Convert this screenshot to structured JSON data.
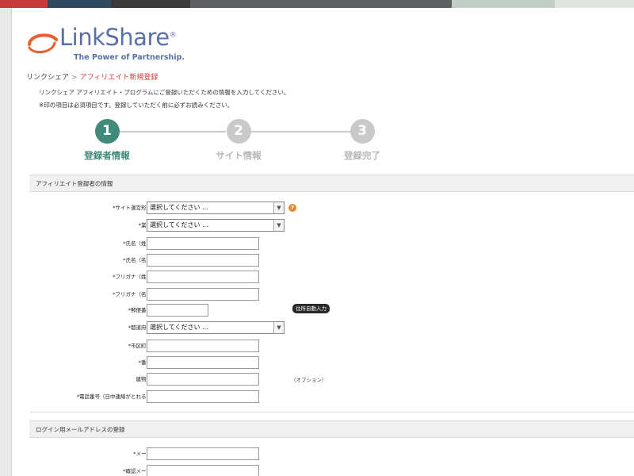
{
  "colors": {
    "topbar": [
      "#c53a3a",
      "#2f4a5e",
      "#3a3a3a",
      "#5f6061",
      "#6f7071",
      "#c3cfc6",
      "#e2e6e3"
    ],
    "logo_blue": "#5a6fa8",
    "logo_orange": "#e8602c",
    "step_active": "#3f8a7a",
    "step_inactive": "#c9c9c9",
    "breadcrumb_current": "#d13c3c"
  },
  "logo": {
    "name": "LinkShare",
    "registered": "®",
    "tagline": "The Power of Partnership."
  },
  "breadcrumb": {
    "home": "リンクシェア",
    "separator": ">",
    "current": "アフィリエイト新規登録"
  },
  "intro": {
    "line1": "リンクシェア アフィリエイト・プログラムにご登録いただくための情報を入力してください。",
    "line2": "※印の項目は必須項目です。登録していただく前に必ずお読みください。"
  },
  "steps": [
    {
      "number": "1",
      "label": "登録者情報",
      "active": true
    },
    {
      "number": "2",
      "label": "サイト情報",
      "active": false
    },
    {
      "number": "3",
      "label": "登録完了",
      "active": false
    }
  ],
  "section1": {
    "title": "アフィリエイト登録者の情報",
    "fields": [
      {
        "label": "*サイト運営形態",
        "type": "select",
        "value": "選択してください ...",
        "help": "?"
      },
      {
        "label": "*業種",
        "type": "select",
        "value": "選択してください ..."
      },
      {
        "label": "*氏名（姓）",
        "type": "input",
        "value": ""
      },
      {
        "label": "*氏名（名）",
        "type": "input",
        "value": ""
      },
      {
        "label": "*フリガナ（姓）",
        "type": "input",
        "value": ""
      },
      {
        "label": "*フリガナ（名）",
        "type": "input",
        "value": ""
      },
      {
        "label": "*郵便番号",
        "type": "input-short",
        "value": "",
        "button": "住所自動入力"
      },
      {
        "label": "*都道府県",
        "type": "select",
        "value": "選択してください ..."
      },
      {
        "label": "*市区町村",
        "type": "input",
        "value": ""
      },
      {
        "label": "*番地",
        "type": "input",
        "value": ""
      },
      {
        "label": "建物名",
        "type": "input",
        "value": "",
        "note": "（オプション）"
      },
      {
        "label": "*電話番号（日中連絡がとれる）",
        "type": "input",
        "value": ""
      }
    ]
  },
  "section2": {
    "title": "ログイン用メールアドレスの登録",
    "fields": [
      {
        "label": "*メール",
        "type": "input",
        "value": ""
      },
      {
        "label": "*確認メール",
        "type": "input",
        "value": ""
      }
    ]
  }
}
